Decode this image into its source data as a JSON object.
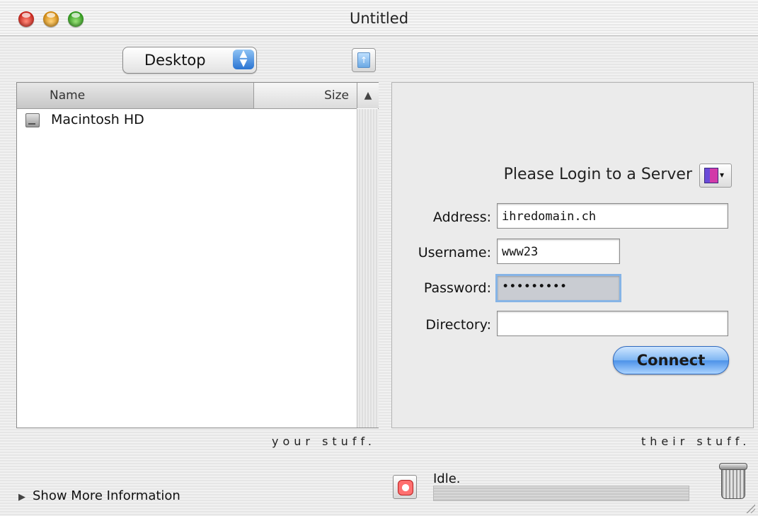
{
  "window": {
    "title": "Untitled"
  },
  "toolbar": {
    "location_popup": "Desktop"
  },
  "file_browser": {
    "columns": {
      "name": "Name",
      "size": "Size"
    },
    "items": [
      {
        "name": "Macintosh HD",
        "icon": "hard-drive-icon"
      }
    ]
  },
  "login": {
    "title": "Please Login to a Server",
    "address_label": "Address:",
    "address_value": "ihredomain.ch",
    "username_label": "Username:",
    "username_value": "www23",
    "password_label": "Password:",
    "password_value": "•••••••••",
    "directory_label": "Directory:",
    "directory_value": "",
    "connect_label": "Connect"
  },
  "captions": {
    "left": "your stuff.",
    "right": "their stuff."
  },
  "footer": {
    "show_more": "Show More Information",
    "status": "Idle.",
    "progress": 0
  },
  "colors": {
    "accent_blue": "#4c92e8",
    "close": "#c9231a",
    "minimize": "#d38a10",
    "zoom": "#2f9a1c"
  }
}
